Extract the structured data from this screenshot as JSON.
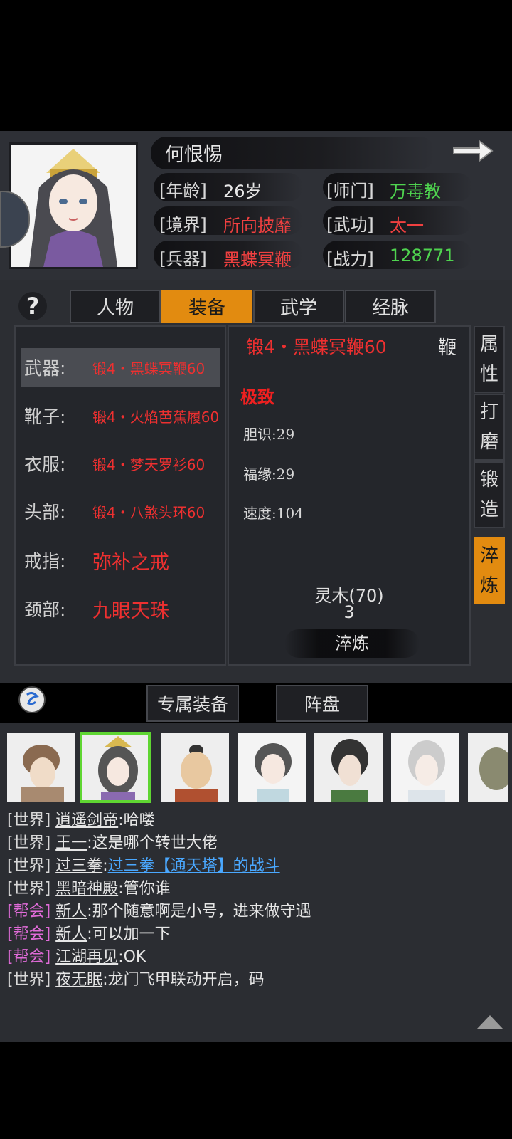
{
  "character": {
    "name": "何恨惕",
    "attrs": {
      "age_label": "[年龄]",
      "age": "26岁",
      "sect_label": "[师门]",
      "sect": "万毒教",
      "realm_label": "[境界]",
      "realm": "所向披靡",
      "skill_label": "[武功]",
      "skill": "太一",
      "weapon_label": "[兵器]",
      "weapon": "黑蝶冥鞭",
      "power_label": "[战力]",
      "power": "128771"
    }
  },
  "tabs": [
    "人物",
    "装备",
    "武学",
    "经脉"
  ],
  "active_tab": "装备",
  "help_label": "?",
  "equipment": [
    {
      "slot": "武器:",
      "name": "锻4・黑蝶冥鞭60",
      "selected": true
    },
    {
      "slot": "靴子:",
      "name": "锻4・火焰芭蕉履60"
    },
    {
      "slot": "衣服:",
      "name": "锻4・梦天罗衫60"
    },
    {
      "slot": "头部:",
      "name": "锻4・八煞头环60"
    },
    {
      "slot": "戒指:",
      "name": "弥补之戒"
    },
    {
      "slot": "颈部:",
      "name": "九眼天珠"
    }
  ],
  "detail": {
    "title": "锻4・黑蝶冥鞭60",
    "type": "鞭",
    "quality": "极致",
    "stats": [
      "胆识:29",
      "福缘:29",
      "速度:104"
    ],
    "material": "灵木(70)",
    "material_count": "3",
    "action": "淬炼"
  },
  "side_tabs": [
    {
      "label1": "属",
      "label2": "性"
    },
    {
      "label1": "打",
      "label2": "磨"
    },
    {
      "label1": "锻",
      "label2": "造"
    },
    {
      "label1": "淬",
      "label2": "炼",
      "active": true
    }
  ],
  "bottom_buttons": [
    "专属装备",
    "阵盘"
  ],
  "chat": [
    {
      "channel": "[世界]",
      "nick": "逍遥剑帝",
      "text": ":哈喽"
    },
    {
      "channel": "[世界]",
      "nick": "王一",
      "text": ":这是哪个转世大佬"
    },
    {
      "channel": "[世界]",
      "nick": "过三拳",
      "text": ":",
      "link": "过三拳【通天塔】的战斗"
    },
    {
      "channel": "[世界]",
      "nick": "黑暗神殿",
      "text": ":管你谁"
    },
    {
      "channel": "[帮会]",
      "nick": "新人",
      "text": ":那个随意啊是小号，进来做守遇"
    },
    {
      "channel": "[帮会]",
      "nick": "新人",
      "text": ":可以加一下"
    },
    {
      "channel": "[帮会]",
      "nick": "江湖再见",
      "text": ":OK"
    },
    {
      "channel": "[世界]",
      "nick": "夜无眠",
      "text": ":龙门飞甲联动开启，码"
    }
  ],
  "colors": {
    "accent": "#e28b10",
    "red": "#f04040",
    "green": "#4fd34f",
    "guild": "#e06bd8",
    "link": "#4aa8ff"
  }
}
